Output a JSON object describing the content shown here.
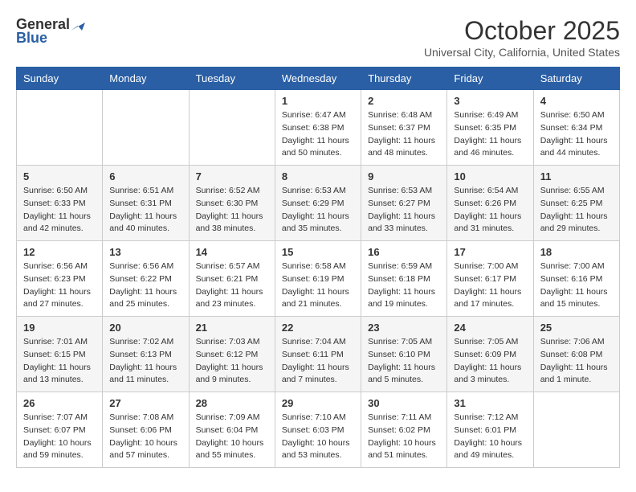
{
  "header": {
    "logo_general": "General",
    "logo_blue": "Blue",
    "month_title": "October 2025",
    "location": "Universal City, California, United States"
  },
  "weekdays": [
    "Sunday",
    "Monday",
    "Tuesday",
    "Wednesday",
    "Thursday",
    "Friday",
    "Saturday"
  ],
  "weeks": [
    [
      {
        "day": "",
        "info": ""
      },
      {
        "day": "",
        "info": ""
      },
      {
        "day": "",
        "info": ""
      },
      {
        "day": "1",
        "info": "Sunrise: 6:47 AM\nSunset: 6:38 PM\nDaylight: 11 hours\nand 50 minutes."
      },
      {
        "day": "2",
        "info": "Sunrise: 6:48 AM\nSunset: 6:37 PM\nDaylight: 11 hours\nand 48 minutes."
      },
      {
        "day": "3",
        "info": "Sunrise: 6:49 AM\nSunset: 6:35 PM\nDaylight: 11 hours\nand 46 minutes."
      },
      {
        "day": "4",
        "info": "Sunrise: 6:50 AM\nSunset: 6:34 PM\nDaylight: 11 hours\nand 44 minutes."
      }
    ],
    [
      {
        "day": "5",
        "info": "Sunrise: 6:50 AM\nSunset: 6:33 PM\nDaylight: 11 hours\nand 42 minutes."
      },
      {
        "day": "6",
        "info": "Sunrise: 6:51 AM\nSunset: 6:31 PM\nDaylight: 11 hours\nand 40 minutes."
      },
      {
        "day": "7",
        "info": "Sunrise: 6:52 AM\nSunset: 6:30 PM\nDaylight: 11 hours\nand 38 minutes."
      },
      {
        "day": "8",
        "info": "Sunrise: 6:53 AM\nSunset: 6:29 PM\nDaylight: 11 hours\nand 35 minutes."
      },
      {
        "day": "9",
        "info": "Sunrise: 6:53 AM\nSunset: 6:27 PM\nDaylight: 11 hours\nand 33 minutes."
      },
      {
        "day": "10",
        "info": "Sunrise: 6:54 AM\nSunset: 6:26 PM\nDaylight: 11 hours\nand 31 minutes."
      },
      {
        "day": "11",
        "info": "Sunrise: 6:55 AM\nSunset: 6:25 PM\nDaylight: 11 hours\nand 29 minutes."
      }
    ],
    [
      {
        "day": "12",
        "info": "Sunrise: 6:56 AM\nSunset: 6:23 PM\nDaylight: 11 hours\nand 27 minutes."
      },
      {
        "day": "13",
        "info": "Sunrise: 6:56 AM\nSunset: 6:22 PM\nDaylight: 11 hours\nand 25 minutes."
      },
      {
        "day": "14",
        "info": "Sunrise: 6:57 AM\nSunset: 6:21 PM\nDaylight: 11 hours\nand 23 minutes."
      },
      {
        "day": "15",
        "info": "Sunrise: 6:58 AM\nSunset: 6:19 PM\nDaylight: 11 hours\nand 21 minutes."
      },
      {
        "day": "16",
        "info": "Sunrise: 6:59 AM\nSunset: 6:18 PM\nDaylight: 11 hours\nand 19 minutes."
      },
      {
        "day": "17",
        "info": "Sunrise: 7:00 AM\nSunset: 6:17 PM\nDaylight: 11 hours\nand 17 minutes."
      },
      {
        "day": "18",
        "info": "Sunrise: 7:00 AM\nSunset: 6:16 PM\nDaylight: 11 hours\nand 15 minutes."
      }
    ],
    [
      {
        "day": "19",
        "info": "Sunrise: 7:01 AM\nSunset: 6:15 PM\nDaylight: 11 hours\nand 13 minutes."
      },
      {
        "day": "20",
        "info": "Sunrise: 7:02 AM\nSunset: 6:13 PM\nDaylight: 11 hours\nand 11 minutes."
      },
      {
        "day": "21",
        "info": "Sunrise: 7:03 AM\nSunset: 6:12 PM\nDaylight: 11 hours\nand 9 minutes."
      },
      {
        "day": "22",
        "info": "Sunrise: 7:04 AM\nSunset: 6:11 PM\nDaylight: 11 hours\nand 7 minutes."
      },
      {
        "day": "23",
        "info": "Sunrise: 7:05 AM\nSunset: 6:10 PM\nDaylight: 11 hours\nand 5 minutes."
      },
      {
        "day": "24",
        "info": "Sunrise: 7:05 AM\nSunset: 6:09 PM\nDaylight: 11 hours\nand 3 minutes."
      },
      {
        "day": "25",
        "info": "Sunrise: 7:06 AM\nSunset: 6:08 PM\nDaylight: 11 hours\nand 1 minute."
      }
    ],
    [
      {
        "day": "26",
        "info": "Sunrise: 7:07 AM\nSunset: 6:07 PM\nDaylight: 10 hours\nand 59 minutes."
      },
      {
        "day": "27",
        "info": "Sunrise: 7:08 AM\nSunset: 6:06 PM\nDaylight: 10 hours\nand 57 minutes."
      },
      {
        "day": "28",
        "info": "Sunrise: 7:09 AM\nSunset: 6:04 PM\nDaylight: 10 hours\nand 55 minutes."
      },
      {
        "day": "29",
        "info": "Sunrise: 7:10 AM\nSunset: 6:03 PM\nDaylight: 10 hours\nand 53 minutes."
      },
      {
        "day": "30",
        "info": "Sunrise: 7:11 AM\nSunset: 6:02 PM\nDaylight: 10 hours\nand 51 minutes."
      },
      {
        "day": "31",
        "info": "Sunrise: 7:12 AM\nSunset: 6:01 PM\nDaylight: 10 hours\nand 49 minutes."
      },
      {
        "day": "",
        "info": ""
      }
    ]
  ]
}
